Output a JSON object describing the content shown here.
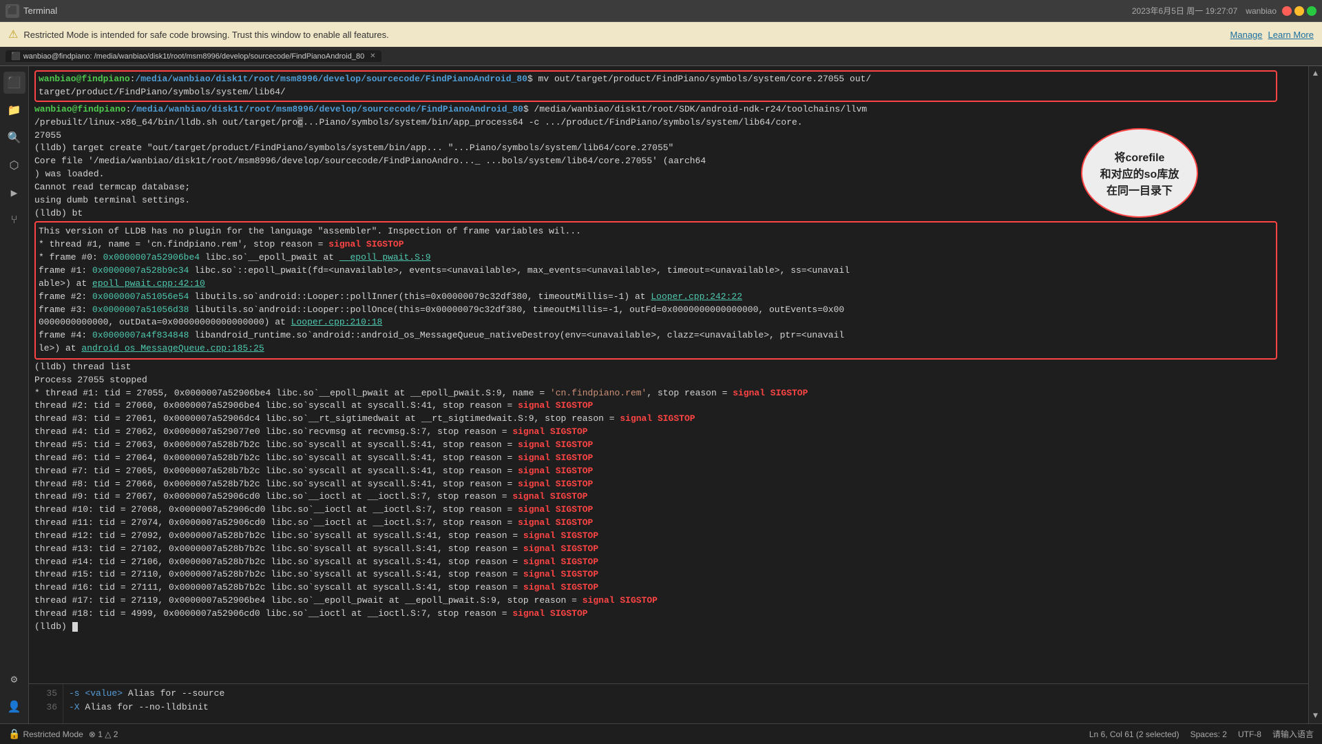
{
  "window": {
    "title": "Terminal",
    "close_label": "×",
    "min_label": "−",
    "max_label": "□"
  },
  "banner": {
    "text": "Restricted Mode is intended for safe code browsing. Trust this window to enable all features.",
    "manage_label": "Manage",
    "learn_more_label": "Learn More"
  },
  "tab": {
    "label": "wanbiao@findpiano: /media/wanbiao/disk1t/root/msm8996/develop/sourcecode/FindPianoAndroid_80"
  },
  "annotation": {
    "text": "将corefile\n和对应的so库放\n在同一目录下"
  },
  "status_bar": {
    "restricted_mode": "Restricted Mode",
    "warnings": "⊗ 1 △ 2",
    "position": "Ln 6, Col 61 (2 selected)",
    "spaces": "Spaces: 2",
    "encoding": "UTF-8"
  },
  "datetime": "2023年6月5日 周一 19:27:07",
  "username": "wanbiao",
  "hostname": "findpiano"
}
